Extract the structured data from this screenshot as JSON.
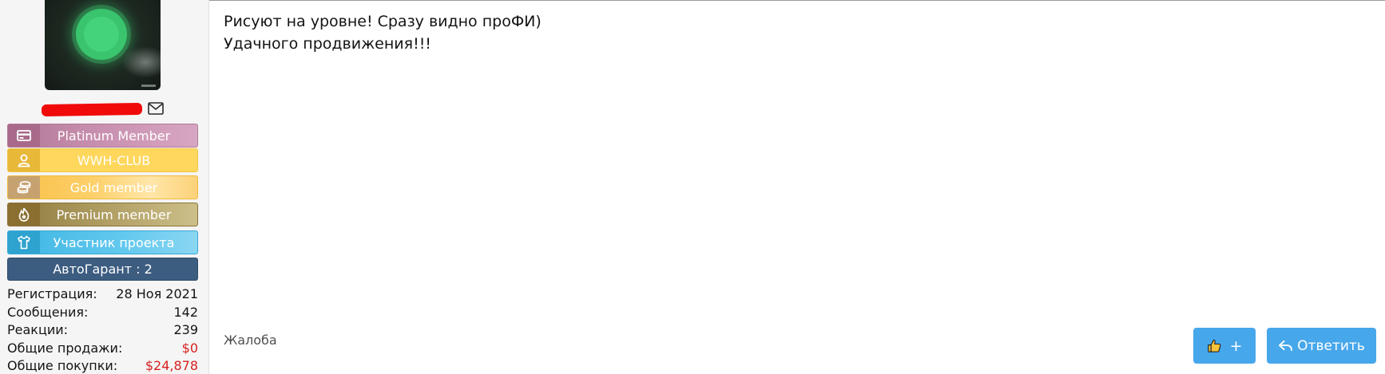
{
  "user": {
    "badges": [
      {
        "label": "Platinum Member",
        "icon": "card-icon"
      },
      {
        "label": "WWH-CLUB",
        "icon": "user-icon"
      },
      {
        "label": "Gold member",
        "icon": "coins-icon"
      },
      {
        "label": "Premium member",
        "icon": "fire-icon"
      },
      {
        "label": "Участник проекта",
        "icon": "shirt-icon"
      }
    ],
    "guarantee": "АвтоГарант : 2",
    "stats": [
      {
        "label": "Регистрация:",
        "value": "28 Ноя 2021"
      },
      {
        "label": "Сообщения:",
        "value": "142"
      },
      {
        "label": "Реакции:",
        "value": "239"
      },
      {
        "label": "Общие продажи:",
        "value": "$0"
      },
      {
        "label": "Общие покупки:",
        "value": "$24,878"
      }
    ]
  },
  "post": {
    "lines": [
      "Рисуют на уровне! Сразу видно проФИ)",
      "Удачного продвижения!!!"
    ]
  },
  "actions": {
    "report": "Жалоба",
    "like_plus": "+",
    "reply": "Ответить"
  },
  "colors": {
    "button": "#47a7eb",
    "money_red": "#d62020",
    "guarantee_bg": "#3c5c80"
  }
}
